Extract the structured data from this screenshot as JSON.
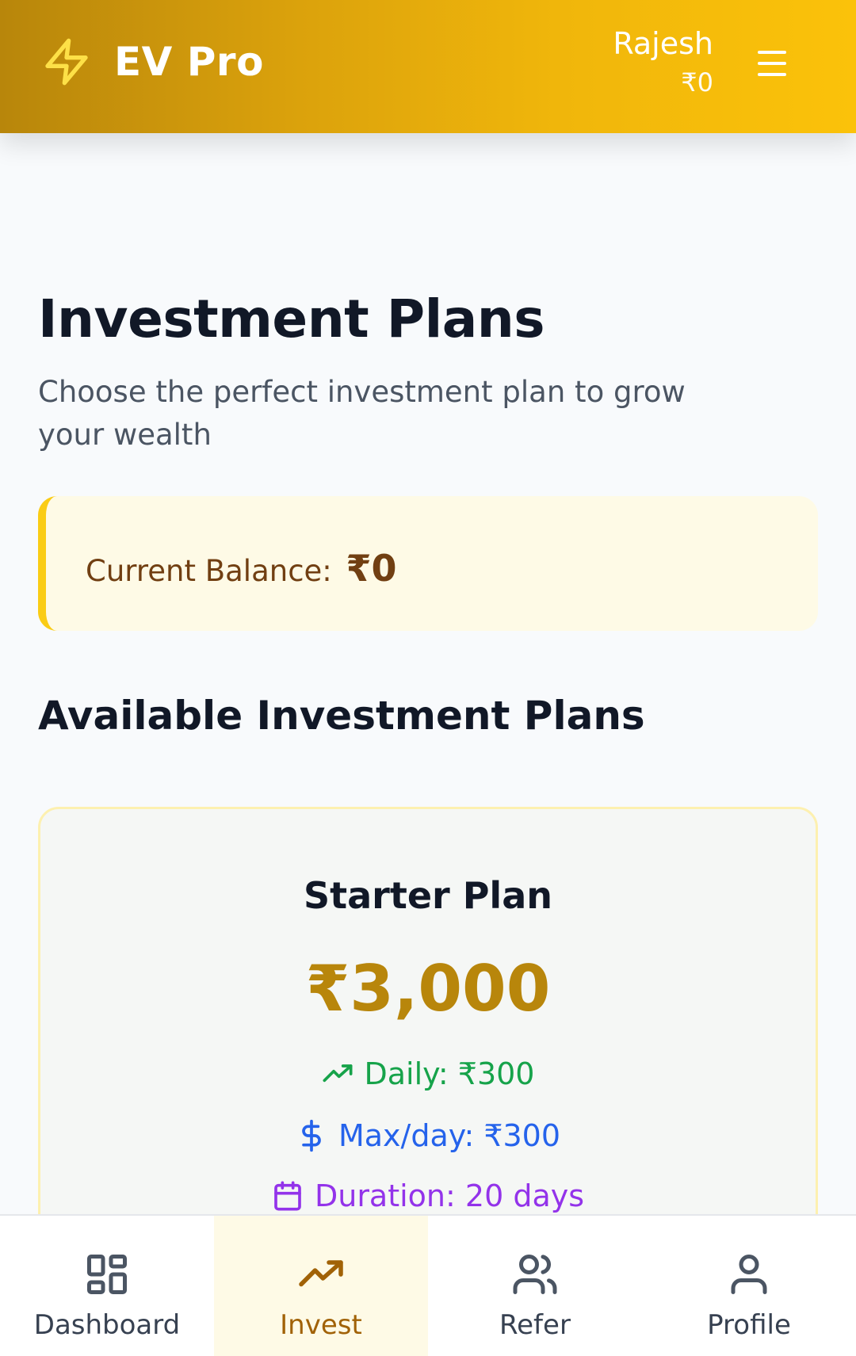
{
  "header": {
    "brand_name": "EV Pro",
    "brand_icon": "lightning-bolt-icon",
    "user_name": "Rajesh",
    "user_balance": "₹0",
    "menu_icon": "hamburger-menu-icon"
  },
  "main": {
    "title": "Investment Plans",
    "subtitle": "Choose the perfect investment plan to grow your wealth",
    "balance_label": "Current Balance:",
    "balance_value": "₹0",
    "section_title": "Available Investment Plans"
  },
  "plan": {
    "name": "Starter Plan",
    "price": "₹3,000",
    "daily": "Daily: ₹300",
    "max_per_day": "Max/day: ₹300",
    "duration": "Duration: 20 days"
  },
  "nav": {
    "items": [
      {
        "label": "Dashboard",
        "icon": "dashboard-grid-icon",
        "active": false
      },
      {
        "label": "Invest",
        "icon": "trending-up-icon",
        "active": true
      },
      {
        "label": "Refer",
        "icon": "users-icon",
        "active": false
      },
      {
        "label": "Profile",
        "icon": "user-icon",
        "active": false
      }
    ]
  },
  "colors": {
    "accent": "#b8860b",
    "daily": "#16a34a",
    "max": "#2563eb",
    "duration": "#9333ea",
    "balance_border": "#facc15"
  }
}
